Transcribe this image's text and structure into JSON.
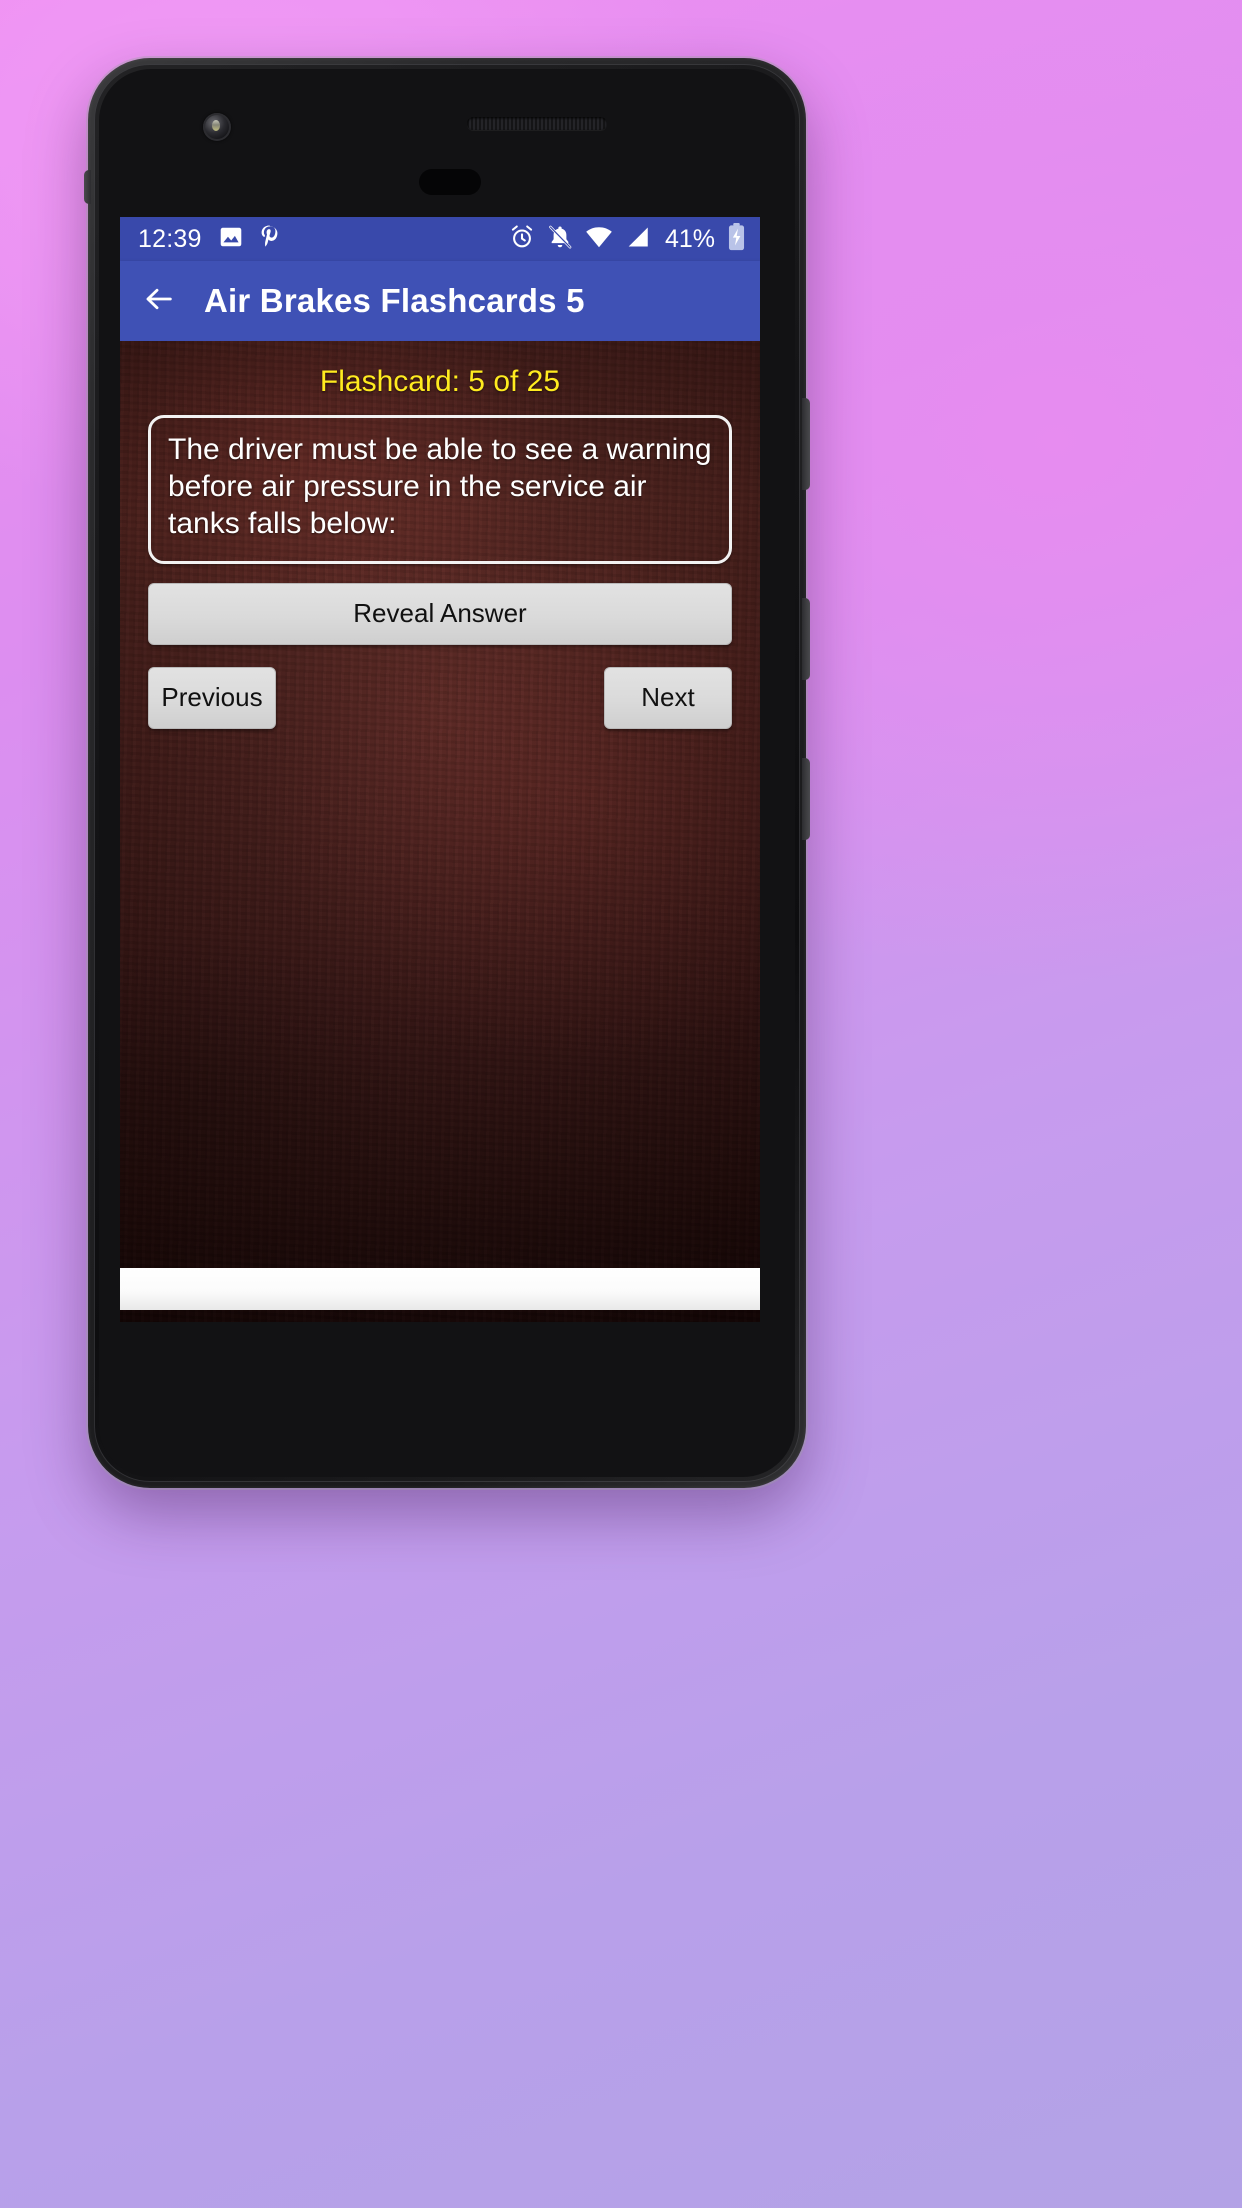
{
  "device": {
    "name": "android-phone",
    "hardware": {
      "front_camera": "camera-icon",
      "earpiece": "speaker-grille",
      "proximity_sensor": "sensor"
    }
  },
  "status_bar": {
    "time": "12:39",
    "left_icons": [
      "image-icon",
      "pinterest-icon"
    ],
    "right_icons": [
      "alarm-icon",
      "notifications-off-icon",
      "wifi-icon",
      "cell-signal-icon"
    ],
    "battery_percent": "41%",
    "battery_icon": "battery-charging-icon",
    "background_color": "#3949ab"
  },
  "app_bar": {
    "back_icon": "back-arrow-icon",
    "title": "Air Brakes Flashcards 5",
    "background_color": "#3f51b5"
  },
  "content": {
    "counter_label": "Flashcard: 5 of 25",
    "counter_color": "#ffeb1f",
    "card_number": 5,
    "card_total": 25,
    "question_text": "The driver must be able to see a warning before air pressure in the service air tanks falls below:",
    "buttons": {
      "reveal": "Reveal Answer",
      "previous": "Previous",
      "next": "Next"
    },
    "background_color": "#4a1a16"
  },
  "ad_banner": {
    "label": "",
    "background_color": "#ffffff"
  }
}
